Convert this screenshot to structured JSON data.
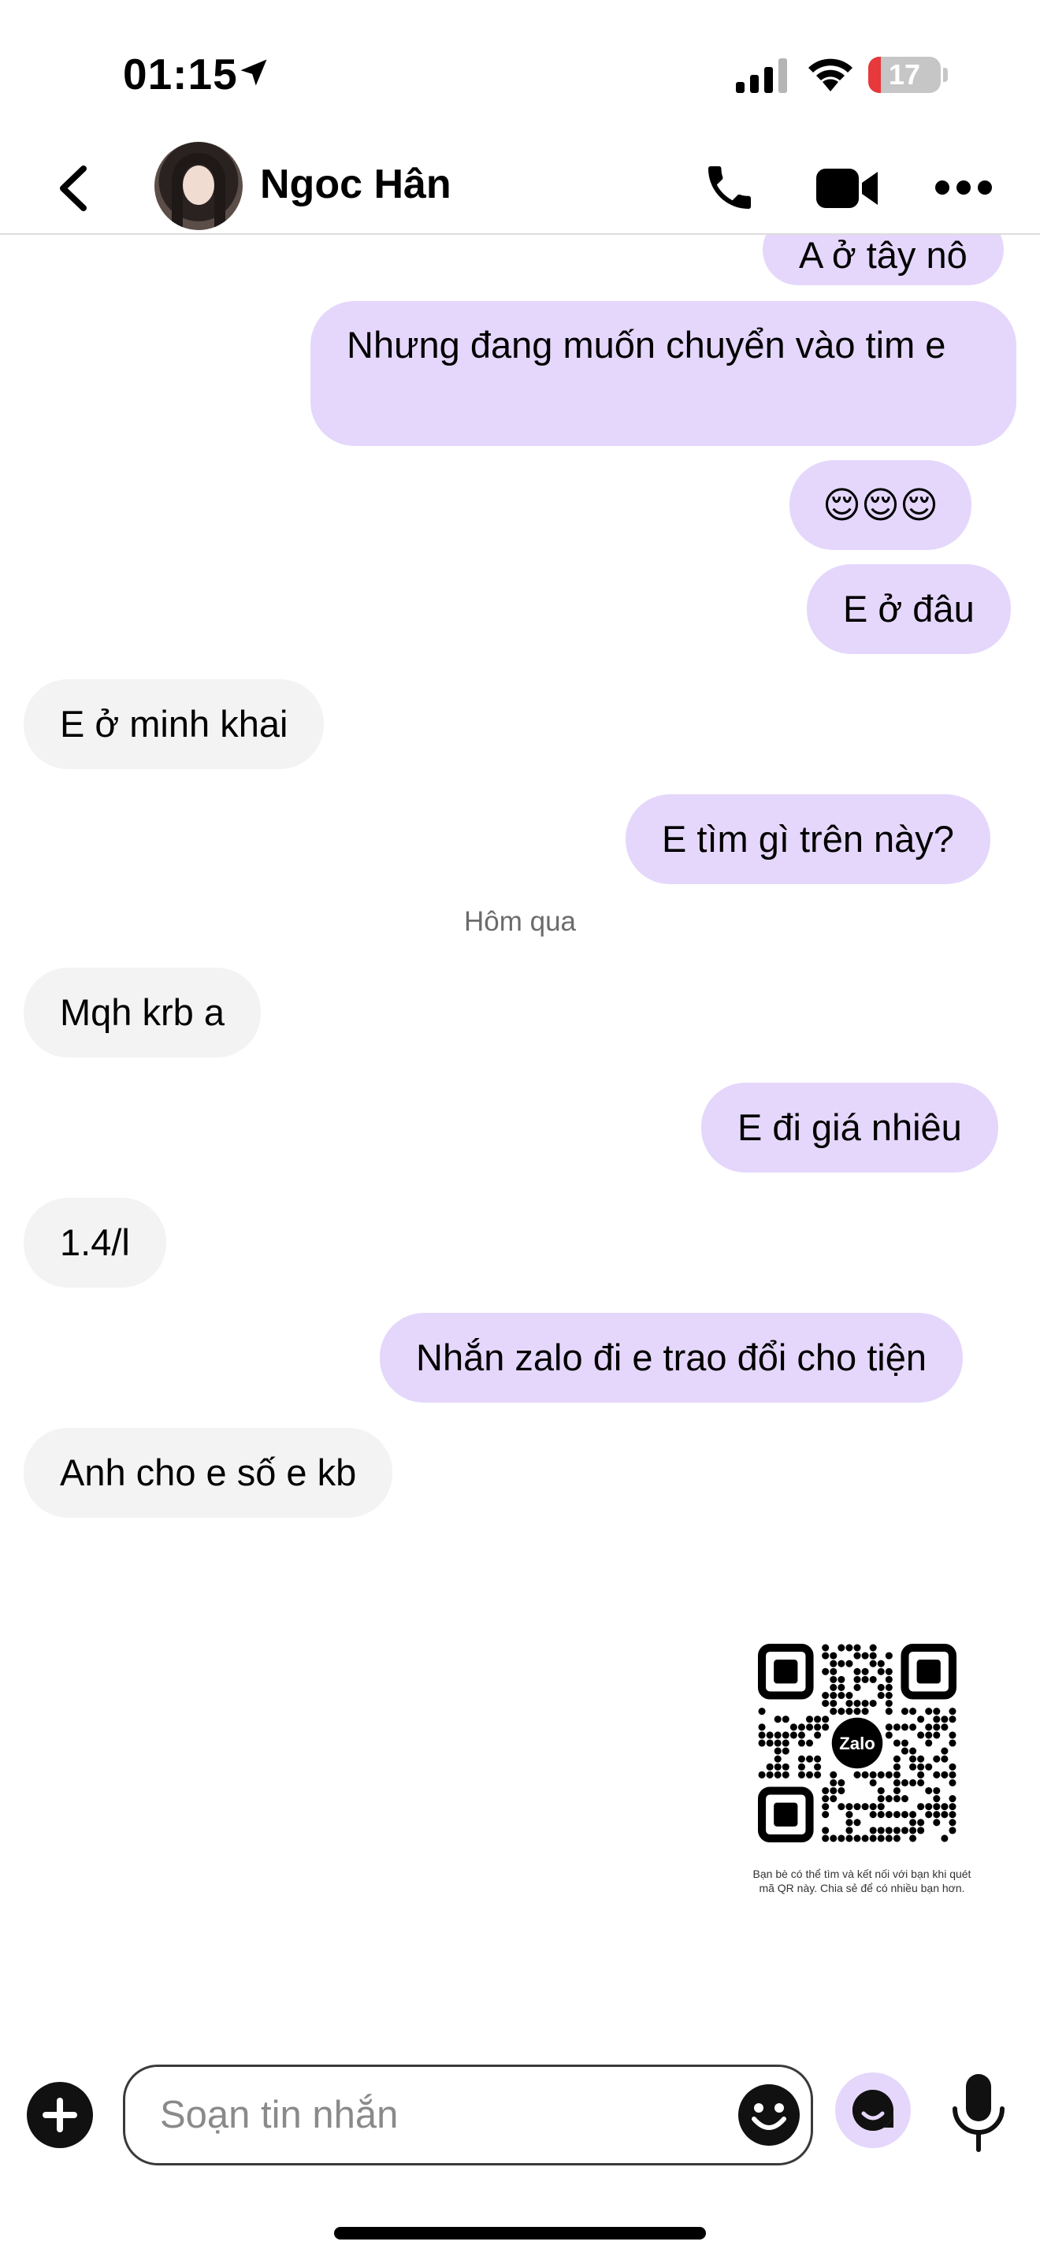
{
  "status_bar": {
    "time": "01:15",
    "battery_level": "17",
    "battery_fraction": 0.17,
    "icons": [
      "location-arrow-icon",
      "cellular-signal-icon",
      "wifi-icon",
      "battery-icon"
    ]
  },
  "header": {
    "contact_name": "Ngoc Hân",
    "icons": [
      "back-chevron-icon",
      "phone-icon",
      "video-camera-icon",
      "more-dots-icon"
    ]
  },
  "messages": [
    {
      "direction": "out",
      "text": "A ở tây nô"
    },
    {
      "direction": "out",
      "text": "Nhưng đang muốn chuyển vào tim e"
    },
    {
      "direction": "out",
      "text": "😌😌😌"
    },
    {
      "direction": "out",
      "text": "E ở đâu"
    },
    {
      "direction": "in",
      "text": "E ở minh khai"
    },
    {
      "direction": "out",
      "text": "E tìm gì trên này?"
    },
    {
      "direction": "in",
      "text": "Mqh krb a"
    },
    {
      "direction": "out",
      "text": "E đi giá nhiêu"
    },
    {
      "direction": "in",
      "text": "1.4/l"
    },
    {
      "direction": "out",
      "text": "Nhắn zalo đi e trao đổi cho tiện"
    },
    {
      "direction": "in",
      "text": "Anh cho e số e kb"
    }
  ],
  "day_separator": "Hôm qua",
  "qr": {
    "logo_text": "Zalo",
    "caption": "Bạn bè có thể tìm và kết nối với bạn khi quét mã QR này. Chia sẻ để có nhiều bạn hơn."
  },
  "composer": {
    "placeholder": "Soạn tin nhắn",
    "icons": [
      "plus-icon",
      "emoji-smile-icon",
      "sticker-icon",
      "microphone-icon"
    ]
  },
  "colors": {
    "outgoing_bubble": "#e5d7fb",
    "incoming_bubble": "#f3f3f3",
    "battery_low": "#e7383c"
  }
}
